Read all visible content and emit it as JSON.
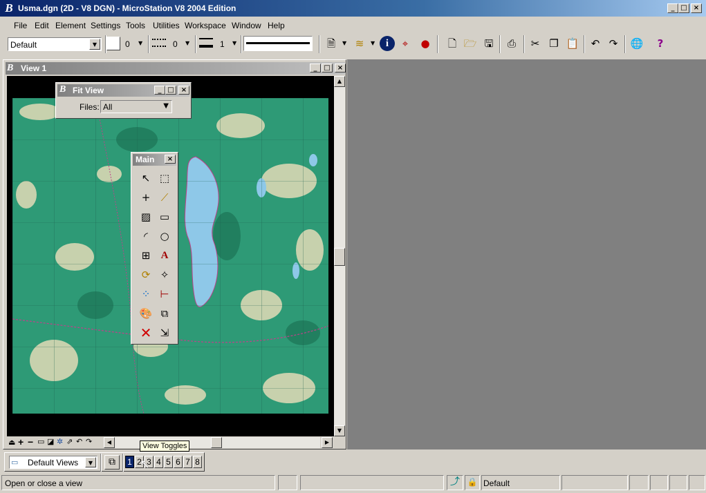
{
  "window": {
    "title": "Usma.dgn (2D - V8 DGN) - MicroStation V8 2004 Edition",
    "logo_icon": "microstation-logo-icon",
    "caption_buttons": [
      "minimize-icon",
      "maximize-icon",
      "close-icon"
    ]
  },
  "menu": [
    "File",
    "Edit",
    "Element",
    "Settings",
    "Tools",
    "Utilities",
    "Workspace",
    "Window",
    "Help"
  ],
  "attributes": {
    "level": "Default",
    "color": "0",
    "style": "0",
    "weight": "1"
  },
  "main_toolbar_icons": [
    "key-in-icon",
    "level-display-icon",
    "element-info-icon",
    "accusnap-icon",
    "render-icon",
    "new-file-icon",
    "open-file-icon",
    "save-icon",
    "print-icon",
    "cut-icon",
    "copy-icon",
    "paste-icon",
    "undo-icon",
    "redo-icon",
    "globe-icon",
    "help-icon"
  ],
  "view": {
    "title": "View 1",
    "bottom_controls": [
      "update-icon",
      "zoom-in-icon",
      "zoom-out-icon",
      "window-area-icon",
      "fit-view-icon",
      "rotate-icon",
      "pan-icon",
      "undo-view-icon",
      "redo-view-icon"
    ]
  },
  "fit_view": {
    "title": "Fit View",
    "files_label": "Files:",
    "files_value": "All"
  },
  "main_palette": {
    "title": "Main",
    "tools": [
      "select-element-icon",
      "fence-icon",
      "place-point-icon",
      "smartline-icon",
      "hatch-icon",
      "rectangle-icon",
      "arc-icon",
      "circle-icon",
      "dimension-icon",
      "text-icon",
      "cell-icon",
      "measure-icon",
      "copy-element-icon",
      "modify-icon",
      "change-attributes-icon",
      "move-icon",
      "delete-icon",
      "scale-icon"
    ]
  },
  "views_bar": {
    "saved_views": "Default Views",
    "view_numbers": [
      "1",
      "2",
      "3",
      "4",
      "5",
      "6",
      "7",
      "8"
    ],
    "active_view": "1"
  },
  "tooltip": "View Toggles",
  "status": {
    "message": "Open or close a view",
    "level": "Default"
  }
}
